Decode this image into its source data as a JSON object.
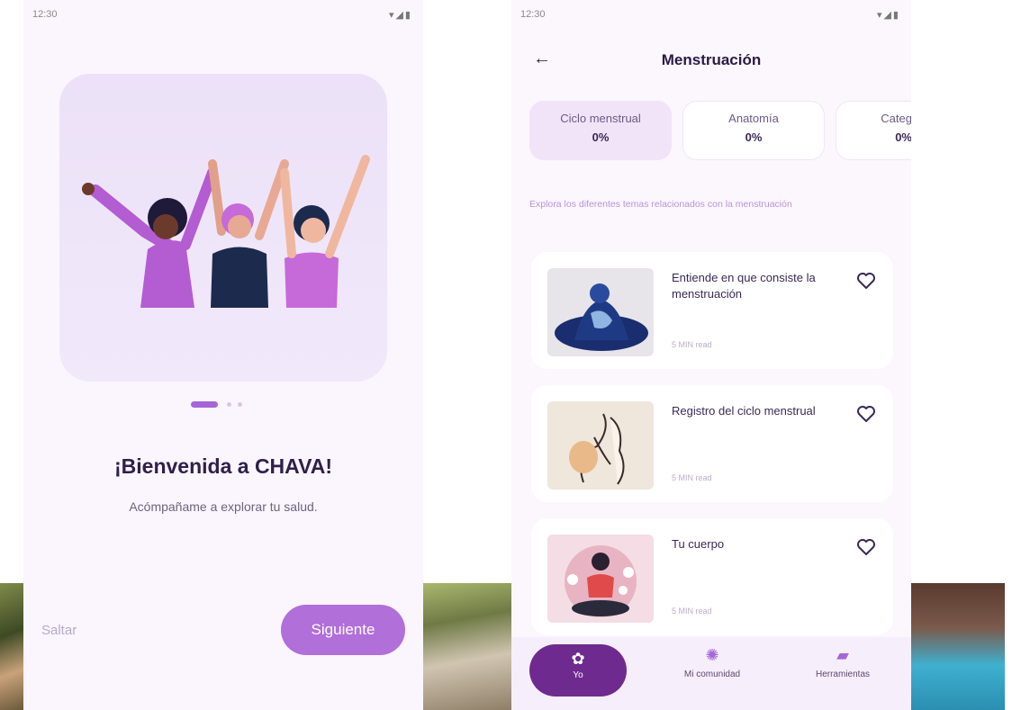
{
  "screen_left": {
    "status_time": "12:30",
    "status_icons": "▾◢▮",
    "pagination": {
      "count": 3,
      "active": 0
    },
    "welcome_title": "¡Bienvenida a CHAVA!",
    "subtitle": "Acómpañame a explorar tu salud.",
    "skip_label": "Saltar",
    "next_label": "Siguiente"
  },
  "screen_right": {
    "status_time": "12:30",
    "status_icons": "▾◢▮",
    "back_icon": "←",
    "title": "Menstruación",
    "chips": [
      {
        "label": "Ciclo menstrual",
        "percent": "0%"
      },
      {
        "label": "Anatomía",
        "percent": "0%"
      },
      {
        "label": "Categ",
        "percent": "0%"
      }
    ],
    "description": "Explora los diferentes temas relacionados con la menstruación",
    "articles": [
      {
        "title": "Entiende en que consiste la menstruación",
        "read_time": "5 MIN read"
      },
      {
        "title": "Registro del ciclo menstrual",
        "read_time": "5 MIN read"
      },
      {
        "title": "Tu cuerpo",
        "read_time": "5 MIN read"
      }
    ],
    "nav": [
      {
        "label": "Yo",
        "icon": "lotus-icon"
      },
      {
        "label": "Mi comunidad",
        "icon": "community-icon"
      },
      {
        "label": "Herramientas",
        "icon": "toolbox-icon"
      }
    ]
  },
  "colors": {
    "accent": "#b16fd9",
    "dark_purple": "#6f2a8f",
    "background": "#fbf5fd"
  }
}
